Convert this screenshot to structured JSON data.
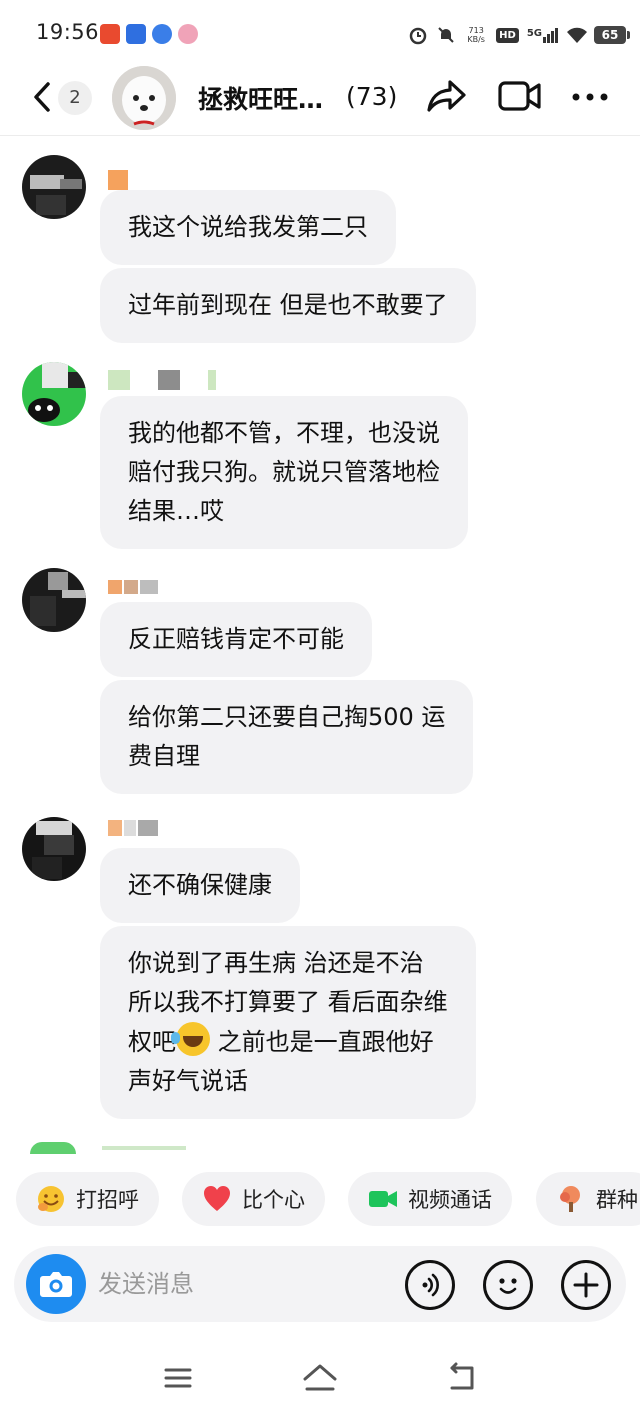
{
  "status_bar": {
    "time": "19:56",
    "network_speed": "713",
    "network_speed_unit": "KB/s",
    "hd_label": "HD",
    "network_type": "5G",
    "battery": "65"
  },
  "header": {
    "unread_count": "2",
    "group_name": "拯救旺旺…",
    "member_count": "(73)"
  },
  "messages": [
    {
      "text": "我这个说给我发第二只"
    },
    {
      "text": "过年前到现在 但是也不敢要了"
    },
    {
      "text_lines": [
        "我的他都不管，不理，也没说",
        "赔付我只狗。就说只管落地检",
        "结果…哎"
      ]
    },
    {
      "text": "反正赔钱肯定不可能"
    },
    {
      "text_lines": [
        "给你第二只还要自己掏500 运",
        "费自理"
      ]
    },
    {
      "text": "还不确保健康"
    },
    {
      "text_lines": [
        "你说到了再生病 治还是不治",
        "所以我不打算要了 看后面杂维",
        "权吧",
        "之前也是一直跟他好",
        "声好气说话"
      ]
    }
  ],
  "quick_replies": [
    {
      "label": "打招呼",
      "icon": "hug-emoji-icon"
    },
    {
      "label": "比个心",
      "icon": "heart-icon"
    },
    {
      "label": "视频通话",
      "icon": "video-camera-icon"
    },
    {
      "label": "群种",
      "icon": "tree-icon"
    }
  ],
  "input": {
    "placeholder": "发送消息"
  },
  "colors": {
    "accent_blue": "#1e8cf0",
    "bubble_bg": "#f2f2f4",
    "heart_red": "#f0414b",
    "video_green": "#1ec45b"
  }
}
